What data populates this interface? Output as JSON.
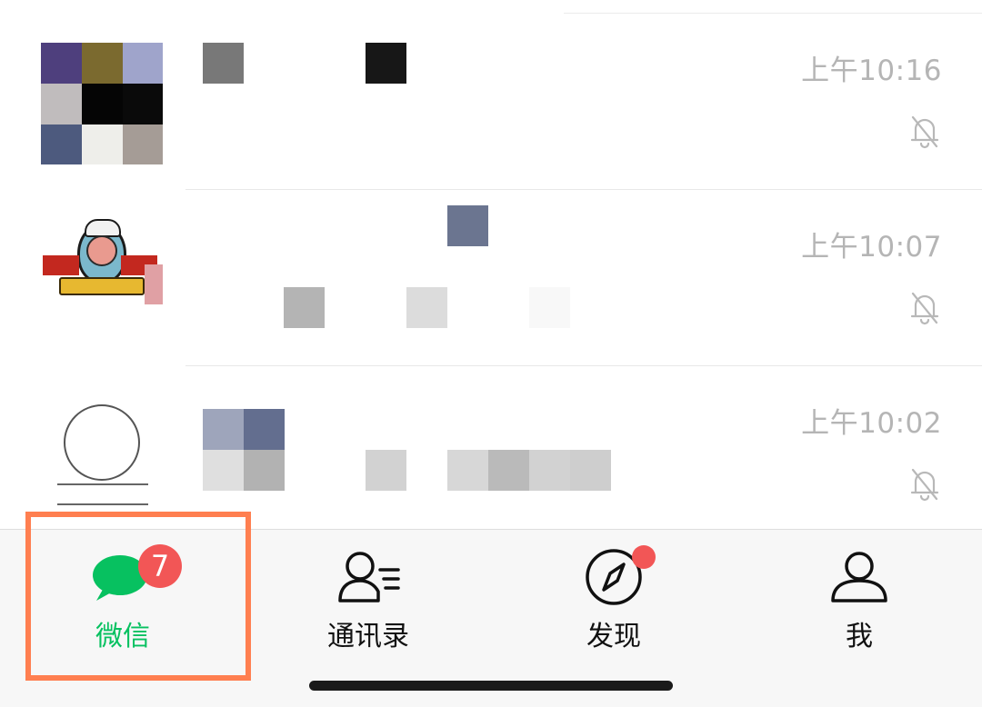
{
  "chats": [
    {
      "time": "上午10:16",
      "muted": true,
      "avatar_icon": "pixelated-avatar"
    },
    {
      "time": "上午10:07",
      "muted": true,
      "avatar_icon": "chef-logo"
    },
    {
      "time": "上午10:02",
      "muted": true,
      "avatar_icon": "yuemu-logo"
    }
  ],
  "tabbar": {
    "tabs": [
      {
        "label": "微信",
        "icon": "chat-bubbles-icon",
        "active": true,
        "badge": "7"
      },
      {
        "label": "通讯录",
        "icon": "contacts-icon",
        "active": false
      },
      {
        "label": "发现",
        "icon": "compass-icon",
        "active": false,
        "dot": true
      },
      {
        "label": "我",
        "icon": "person-icon",
        "active": false
      }
    ]
  },
  "colors": {
    "active_green": "#07c160",
    "badge_red": "#f25656",
    "highlight": "#ff7f50",
    "time_gray": "#b5b5b5"
  }
}
